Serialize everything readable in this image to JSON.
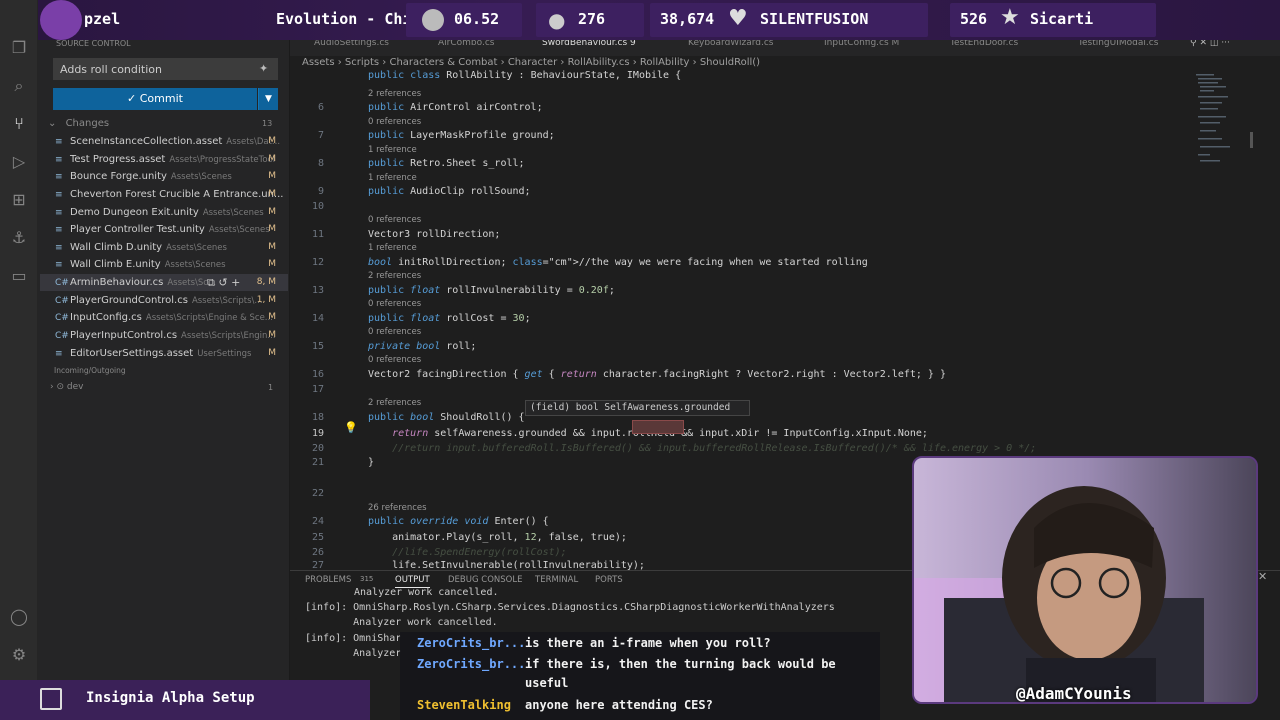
{
  "stream": {
    "channel_fragment": "pzel",
    "game_title": "Evolution - Chi",
    "timer": "06.52",
    "viewers": "276",
    "followers": "38,674",
    "latest_follower": "SILENTFUSION",
    "subs": "526",
    "latest_sub": "Sicarti",
    "setup_label": "Insignia Alpha Setup",
    "handle": "@AdamCYounis"
  },
  "sidebar": {
    "header": "SOURCE CONTROL",
    "commit_message": "Adds roll condition",
    "commit_label": "Commit",
    "changes_label": "Changes",
    "changes_count": "13",
    "files": [
      {
        "name": "SceneInstanceCollection.asset",
        "path": "Assets\\Dat...",
        "status": "M"
      },
      {
        "name": "Test Progress.asset",
        "path": "Assets\\ProgressStateTool",
        "status": "M"
      },
      {
        "name": "Bounce Forge.unity",
        "path": "Assets\\Scenes",
        "status": "M"
      },
      {
        "name": "Cheverton Forest Crucible A Entrance.un...",
        "path": "",
        "status": "M"
      },
      {
        "name": "Demo Dungeon Exit.unity",
        "path": "Assets\\Scenes",
        "status": "M"
      },
      {
        "name": "Player Controller Test.unity",
        "path": "Assets\\Scenes",
        "status": "M"
      },
      {
        "name": "Wall Climb D.unity",
        "path": "Assets\\Scenes",
        "status": "M"
      },
      {
        "name": "Wall Climb E.unity",
        "path": "Assets\\Scenes",
        "status": "M"
      },
      {
        "name": "ArminBehaviour.cs",
        "path": "Assets\\Sc...",
        "status": "8, M"
      },
      {
        "name": "PlayerGroundControl.cs",
        "path": "Assets\\Scripts\\...",
        "status": "1, M"
      },
      {
        "name": "InputConfig.cs",
        "path": "Assets\\Scripts\\Engine & Sce...",
        "status": "M"
      },
      {
        "name": "PlayerInputControl.cs",
        "path": "Assets\\Scripts\\Engin...",
        "status": "M"
      },
      {
        "name": "EditorUserSettings.asset",
        "path": "UserSettings",
        "status": "M"
      }
    ],
    "incoming_label": "Incoming/Outgoing",
    "dev_label": "dev",
    "dev_count": "1"
  },
  "tabs": [
    "AudioSettings.cs",
    "AirCombo.cs",
    "SwordBehaviour.cs 9",
    "KeyboardWizard.cs",
    "InputConfig.cs M",
    "TestEndDoor.cs",
    "TestingUIModal.cs"
  ],
  "breadcrumb": [
    "Assets",
    "Scripts",
    "Characters & Combat",
    "Character",
    "RollAbility.cs",
    "RollAbility",
    "ShouldRoll()"
  ],
  "editor": {
    "hover_text": "(field) bool SelfAwareness.grounded",
    "lines": [
      {
        "ln": "",
        "ref": "",
        "code": "public class RollAbility : BehaviourState, IMobile {"
      },
      {
        "ln": "6",
        "ref": "2 references",
        "code": "public AirControl airControl;"
      },
      {
        "ln": "7",
        "ref": "0 references",
        "code": "public LayerMaskProfile ground;"
      },
      {
        "ln": "8",
        "ref": "1 reference",
        "code": "public Retro.Sheet s_roll;"
      },
      {
        "ln": "9",
        "ref": "1 reference",
        "code": "public AudioClip rollSound;"
      },
      {
        "ln": "10",
        "ref": "",
        "code": ""
      },
      {
        "ln": "11",
        "ref": "0 references",
        "code": "Vector3 rollDirection;"
      },
      {
        "ln": "12",
        "ref": "1 reference",
        "code": "bool initRollDirection; //the way we were facing when we started rolling"
      },
      {
        "ln": "13",
        "ref": "2 references",
        "code": "public float rollInvulnerability = 0.20f;"
      },
      {
        "ln": "14",
        "ref": "0 references",
        "code": "public float rollCost = 30;"
      },
      {
        "ln": "15",
        "ref": "0 references",
        "code": "private bool roll;"
      },
      {
        "ln": "16",
        "ref": "0 references",
        "code": "Vector2 facingDirection { get { return character.facingRight ? Vector2.right : Vector2.left; } }"
      },
      {
        "ln": "17",
        "ref": "",
        "code": ""
      },
      {
        "ln": "18",
        "ref": "2 references",
        "code": "public bool ShouldRoll() {"
      },
      {
        "ln": "19",
        "ref": "",
        "code": "    return selfAwareness.grounded && input.rollHeld && input.xDir != InputConfig.xInput.None;"
      },
      {
        "ln": "20",
        "ref": "",
        "code": "    //return input.bufferedRoll.IsBuffered() && input.bufferedRollRelease.IsBuffered()/* && life.energy > 0 */;"
      },
      {
        "ln": "21",
        "ref": "",
        "code": "}"
      },
      {
        "ln": "22",
        "ref": "",
        "code": ""
      },
      {
        "ln": "23",
        "ref": "",
        "code": ""
      },
      {
        "ln": "24",
        "ref": "26 references",
        "code": "public override void Enter() {"
      },
      {
        "ln": "25",
        "ref": "",
        "code": "    animator.Play(s_roll, 12, false, true);"
      },
      {
        "ln": "26",
        "ref": "",
        "code": "    //life.SpendEnergy(rollCost);"
      },
      {
        "ln": "27",
        "ref": "",
        "code": "    life.SetInvulnerable(rollInvulnerability);"
      }
    ]
  },
  "panel": {
    "tabs": [
      "PROBLEMS",
      "315",
      "OUTPUT",
      "DEBUG CONSOLE",
      "TERMINAL",
      "PORTS"
    ],
    "output": [
      "Analyzer work cancelled.",
      "[info]: OmniSharp.Roslyn.CSharp.Services.Diagnostics.CSharpDiagnosticWorkerWithAnalyzers",
      "        Analyzer work cancelled.",
      "[info]: OmniShar",
      "        Analyzer"
    ]
  },
  "chat": [
    {
      "user": "ZeroCrits_br...",
      "msg": "is there an i-frame when you roll?"
    },
    {
      "user": "ZeroCrits_br...",
      "msg": "if there is, then the turning back would be"
    },
    {
      "user": "",
      "msg": "useful"
    },
    {
      "user": "StevenTalking",
      "msg": "anyone here attending CES?"
    }
  ],
  "colors": {
    "chat_user_blue": "#6fa8ff",
    "chat_user_yellow": "#f0c030",
    "accent": "#0e639c"
  }
}
